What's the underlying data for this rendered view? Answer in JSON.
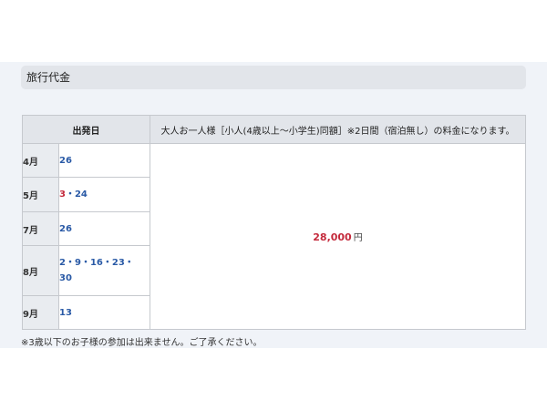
{
  "section": {
    "title": "旅行代金"
  },
  "table": {
    "header_departure": "出発日",
    "header_note": "大人お一人様［小人(4歳以上～小学生)同額］※2日間（宿泊無し）の料金になります。",
    "rows": [
      {
        "month": "4月",
        "dates": [
          {
            "text": "26",
            "color": "blue"
          }
        ]
      },
      {
        "month": "5月",
        "dates": [
          {
            "text": "3",
            "color": "red"
          },
          {
            "text": "24",
            "color": "blue"
          }
        ]
      },
      {
        "month": "7月",
        "dates": [
          {
            "text": "26",
            "color": "blue"
          }
        ]
      },
      {
        "month": "8月",
        "dates": [
          {
            "text": "2",
            "color": "blue"
          },
          {
            "text": "9",
            "color": "blue"
          },
          {
            "text": "16",
            "color": "blue"
          },
          {
            "text": "23",
            "color": "blue"
          },
          {
            "text": "30",
            "color": "blue"
          }
        ]
      },
      {
        "month": "9月",
        "dates": [
          {
            "text": "13",
            "color": "blue"
          }
        ]
      }
    ],
    "price": {
      "amount": "28,000",
      "currency": "円"
    },
    "date_separator": "・"
  },
  "footnote": "※3歳以下のお子様の参加は出来ません。ご了承ください。",
  "colors": {
    "blue": "#2a5aa6",
    "red": "#c42a3c",
    "header_bg": "#e2e5ea",
    "band_bg": "#f0f3f8"
  }
}
